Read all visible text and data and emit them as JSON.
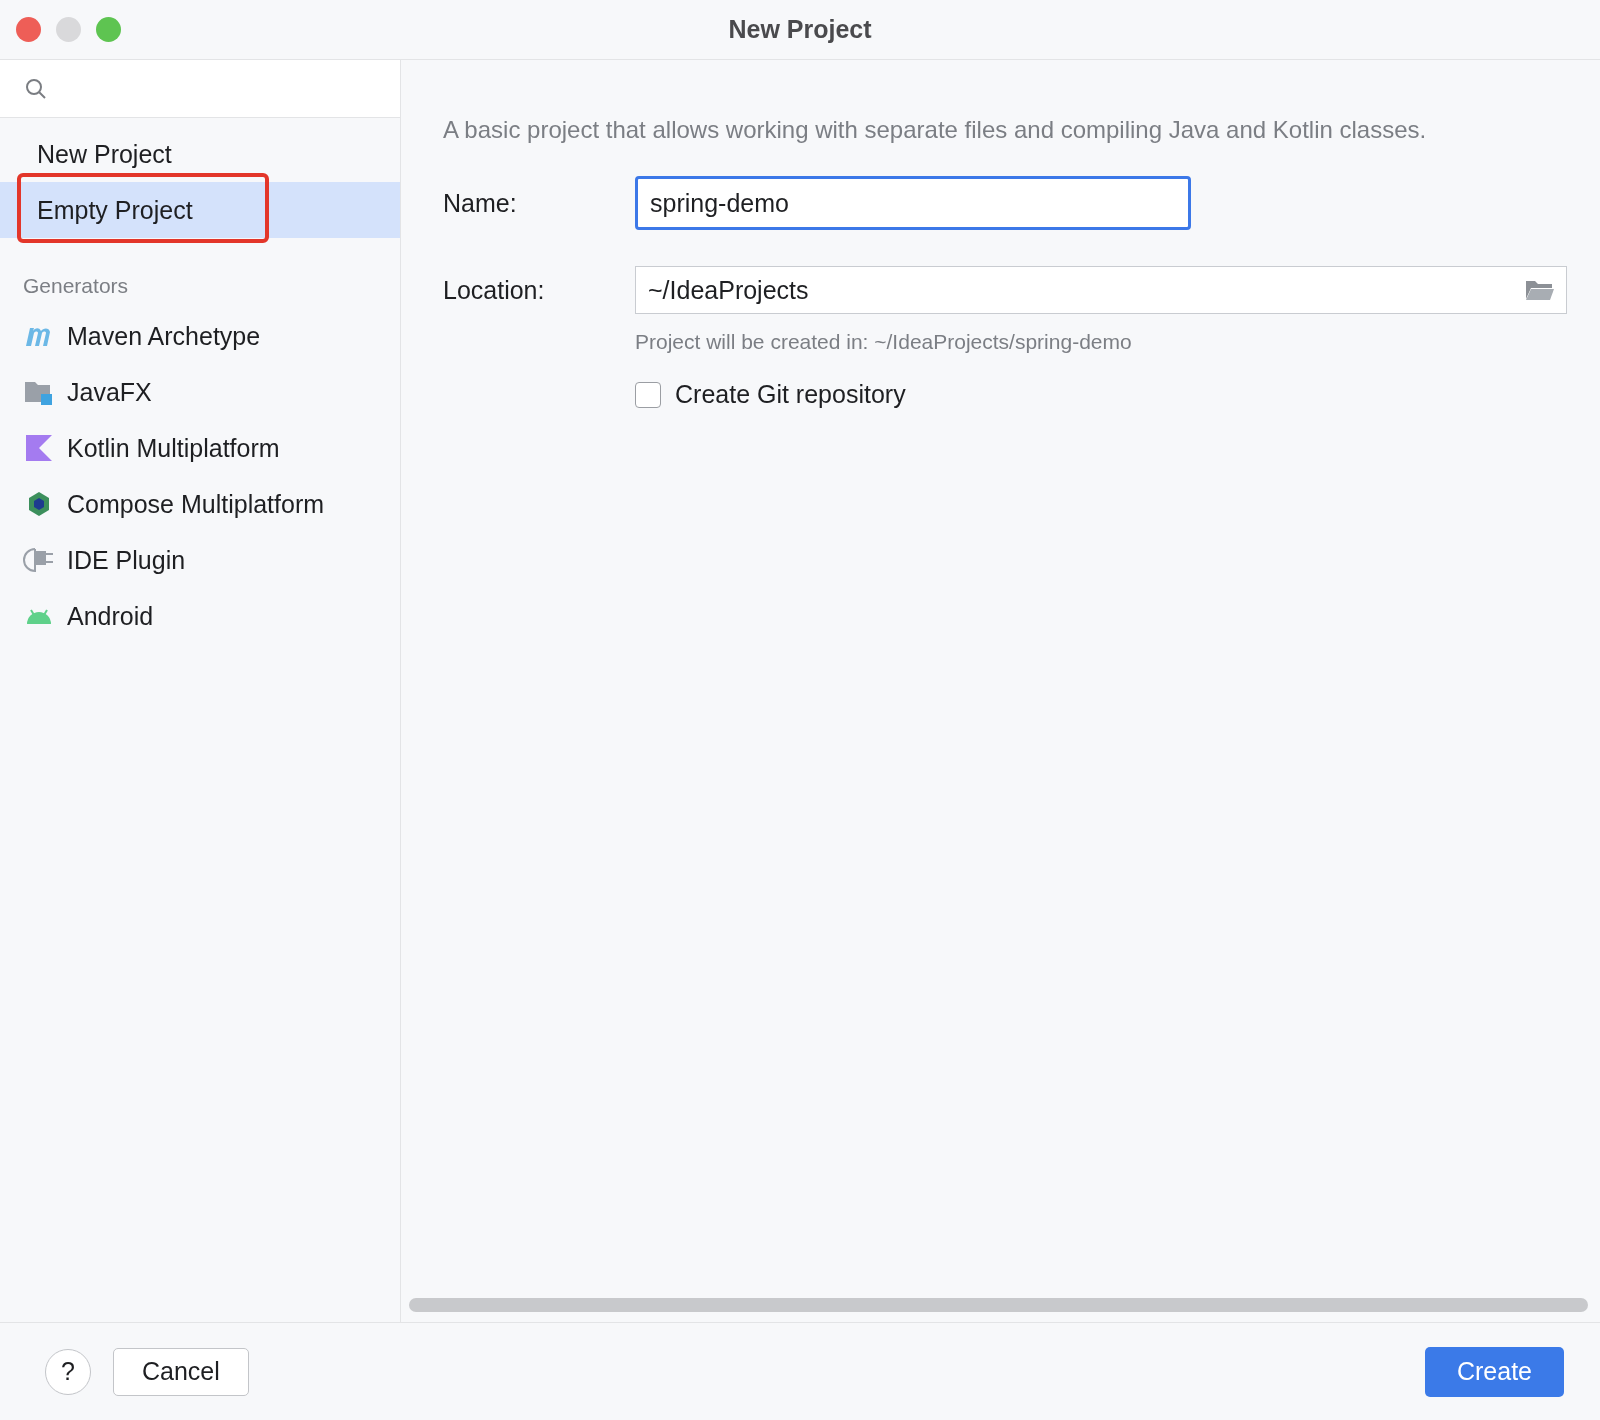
{
  "window": {
    "title": "New Project"
  },
  "sidebar": {
    "items": [
      {
        "label": "New Project",
        "selected": false,
        "annotated": false
      },
      {
        "label": "Empty Project",
        "selected": true,
        "annotated": true
      }
    ],
    "section_title": "Generators",
    "generators": [
      {
        "label": "Maven Archetype",
        "kind": "maven",
        "selected": false
      },
      {
        "label": "JavaFX",
        "kind": "javafx",
        "selected": false
      },
      {
        "label": "Kotlin Multiplatform",
        "kind": "kotlin",
        "selected": false
      },
      {
        "label": "Compose Multiplatform",
        "kind": "compose",
        "selected": false
      },
      {
        "label": "IDE Plugin",
        "kind": "plugin",
        "selected": false
      },
      {
        "label": "Android",
        "kind": "android",
        "selected": false
      }
    ]
  },
  "form": {
    "description": "A basic project that allows working with separate files and compiling Java and Kotlin classes.",
    "name_label": "Name:",
    "name_value": "spring-demo",
    "location_label": "Location:",
    "location_value": "~/IdeaProjects",
    "hint": "Project will be created in: ~/IdeaProjects/spring-demo",
    "git": {
      "label": "Create Git repository",
      "checked": false
    }
  },
  "buttons": {
    "help": "?",
    "cancel": "Cancel",
    "create": "Create"
  }
}
